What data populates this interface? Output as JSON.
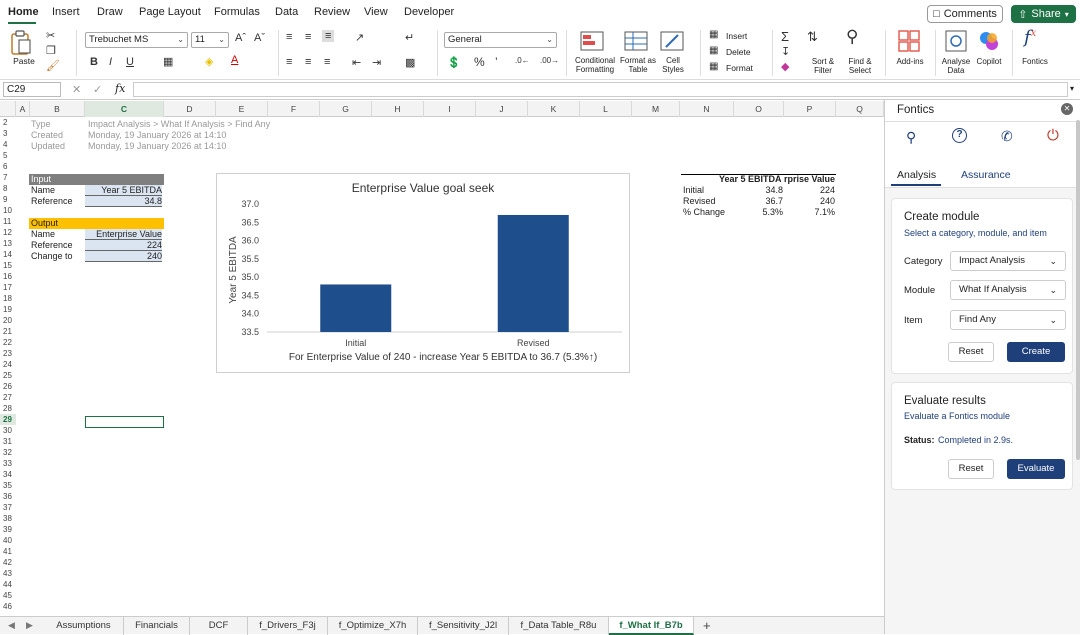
{
  "ribbon_tabs": [
    "Home",
    "Insert",
    "Draw",
    "Page Layout",
    "Formulas",
    "Data",
    "Review",
    "View",
    "Developer"
  ],
  "comments_label": "Comments",
  "share_label": "Share",
  "ribbon": {
    "paste": "Paste",
    "font_name": "Trebuchet MS",
    "font_size": "11",
    "number_format": "General",
    "conditional_formatting": "Conditional Formatting",
    "format_as_table": "Format as Table",
    "cell_styles": "Cell Styles",
    "insert": "Insert",
    "delete": "Delete",
    "format": "Format",
    "sort_filter": "Sort & Filter",
    "find_select": "Find & Select",
    "add_ins": "Add-ins",
    "analyse_data": "Analyse Data",
    "copilot": "Copilot",
    "fontics": "Fontics"
  },
  "formula_bar": {
    "name_box": "C29",
    "fx": "fx"
  },
  "columns": [
    "A",
    "B",
    "C",
    "D",
    "E",
    "F",
    "G",
    "H",
    "I",
    "J",
    "K",
    "L",
    "M",
    "N",
    "O",
    "P",
    "Q"
  ],
  "sheet": {
    "meta": [
      {
        "label": "Type",
        "value": "Impact Analysis > What If Analysis > Find Any"
      },
      {
        "label": "Created",
        "value": "Monday, 19 January 2026 at 14:10"
      },
      {
        "label": "Updated",
        "value": "Monday, 19 January 2026 at 14:10"
      }
    ],
    "input": {
      "header": "Input",
      "name_label": "Name",
      "name_value": "Year 5 EBITDA",
      "ref_label": "Reference",
      "ref_value": "34.8"
    },
    "output": {
      "header": "Output",
      "name_label": "Name",
      "name_value": "Enterprise Value",
      "ref_label": "Reference",
      "ref_value": "224",
      "change_label": "Change to",
      "change_value": "240"
    },
    "summary": {
      "headers": [
        "",
        "Year 5 EBITDA",
        "rprise Value"
      ],
      "rows": [
        [
          "Initial",
          "34.8",
          "224"
        ],
        [
          "Revised",
          "36.7",
          "240"
        ],
        [
          "% Change",
          "5.3%",
          "7.1%"
        ]
      ]
    }
  },
  "chart_data": {
    "type": "bar",
    "title": "Enterprise Value goal seek",
    "categories": [
      "Initial",
      "Revised"
    ],
    "values": [
      34.8,
      36.7
    ],
    "ylabel": "Year 5 EBITDA",
    "xlabel": "For Enterprise Value of 240 - increase Year 5 EBITDA to 36.7 (5.3%↑)",
    "ylim": [
      33.5,
      37.0
    ],
    "yticks": [
      "37.0",
      "36.5",
      "36.0",
      "35.5",
      "35.0",
      "34.5",
      "34.0",
      "33.5"
    ],
    "bar_color": "#1f4e8c",
    "grid": false
  },
  "sheet_tabs": [
    "Assumptions",
    "Financials",
    "DCF",
    "f_Drivers_F3j",
    "f_Optimize_X7h",
    "f_Sensitivity_J2l",
    "f_Data Table_R8u",
    "f_What If_B7b"
  ],
  "active_sheet": "f_What If_B7b",
  "panel": {
    "title": "Fontics",
    "tabs": [
      "Analysis",
      "Assurance"
    ],
    "create": {
      "title": "Create module",
      "subtitle": "Select a category, module, and item",
      "category_label": "Category",
      "category_value": "Impact Analysis",
      "module_label": "Module",
      "module_value": "What If Analysis",
      "item_label": "Item",
      "item_value": "Find Any",
      "reset": "Reset",
      "create": "Create"
    },
    "evaluate": {
      "title": "Evaluate results",
      "subtitle": "Evaluate a Fontics module",
      "status_label": "Status:",
      "status_value": "Completed in 2.9s.",
      "reset": "Reset",
      "evaluate": "Evaluate"
    }
  },
  "colors": {
    "accent": "#1e7145",
    "input_header": "#7f7f7f",
    "output_header": "#ffc000",
    "primary_button": "#1f3f7a"
  }
}
